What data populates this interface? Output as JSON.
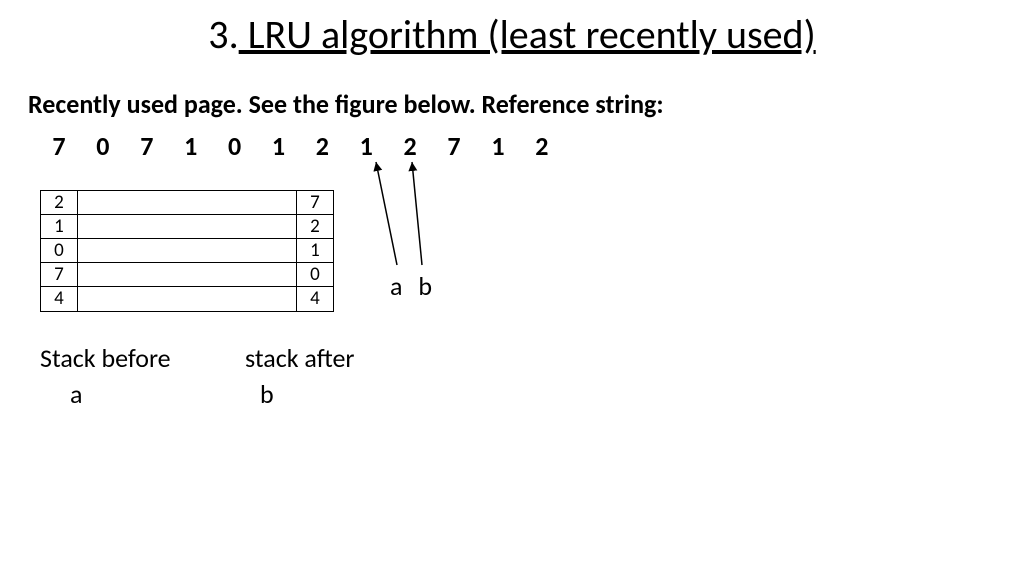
{
  "title": {
    "num": "3.",
    "text": " LRU algorithm (least recently used)"
  },
  "subtitle": "Recently used page. See the figure below. Reference string:",
  "reference_string": [
    "7",
    "0",
    "7",
    "1",
    "0",
    "1",
    "2",
    "1",
    "2",
    "7",
    "1",
    "2"
  ],
  "stack_before": [
    "2",
    "1",
    "0",
    "7",
    "4"
  ],
  "stack_after": [
    "7",
    "2",
    "1",
    "0",
    "4"
  ],
  "labels": {
    "stack_before": "Stack before",
    "stack_after": "stack after",
    "a": "a",
    "b": "b"
  },
  "ab": {
    "a": "a",
    "b": "b"
  }
}
